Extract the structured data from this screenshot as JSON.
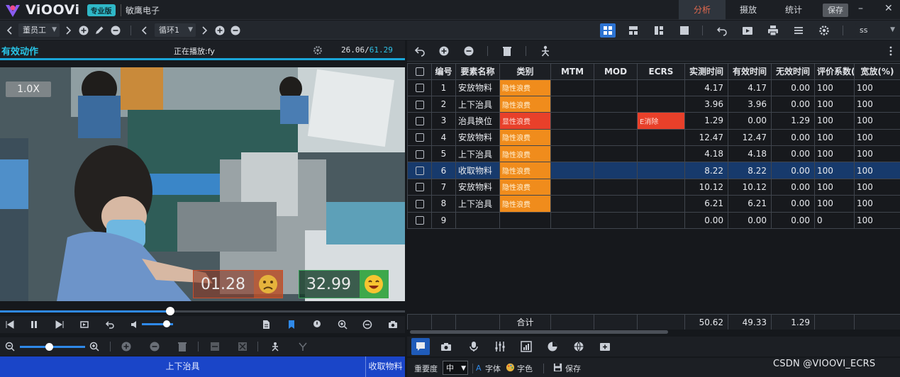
{
  "app": {
    "name": "ViOOVi",
    "edition_badge": "专业版",
    "company": "敏鹰电子"
  },
  "top_tabs": {
    "analysis": "分析",
    "playback": "摄放",
    "stats": "统计"
  },
  "top_save": "保存",
  "toolbar": {
    "operator_select": "董员工",
    "cycle_select": "循环1",
    "right_select": "ss"
  },
  "video": {
    "section_title": "有效动作",
    "playing_label": "正在播放:fy",
    "time_current": "26.06/",
    "time_total": "61.29",
    "speed": "1.0X",
    "timer_waste": "01.28",
    "timer_valid": "32.99",
    "scrub_progress": 0.42,
    "volume_level": 0.8,
    "zoom_level": 0.45
  },
  "timeline": {
    "current": "上下治具",
    "next": "收取物料"
  },
  "table": {
    "headers": [
      "编号",
      "要素名称",
      "类别",
      "MTM",
      "MOD",
      "ECRS",
      "实测时间",
      "有效时间",
      "无效时间",
      "评价系数(%",
      "宽放(%)"
    ],
    "rows": [
      {
        "no": "1",
        "name": "安放物料",
        "category": "隐性浪费",
        "cat_color": "orange",
        "mtm": "",
        "mod": "",
        "ecrs": "",
        "measured": "4.17",
        "valid": "4.17",
        "invalid": "0.00",
        "rating": "100",
        "allowance": "100"
      },
      {
        "no": "2",
        "name": "上下治具",
        "category": "隐性浪费",
        "cat_color": "orange",
        "mtm": "",
        "mod": "",
        "ecrs": "",
        "measured": "3.96",
        "valid": "3.96",
        "invalid": "0.00",
        "rating": "100",
        "allowance": "100"
      },
      {
        "no": "3",
        "name": "治具换位",
        "category": "显性浪费",
        "cat_color": "red",
        "mtm": "",
        "mod": "",
        "ecrs": "E消除",
        "measured": "1.29",
        "valid": "0.00",
        "invalid": "1.29",
        "rating": "100",
        "allowance": "100"
      },
      {
        "no": "4",
        "name": "安放物料",
        "category": "隐性浪费",
        "cat_color": "orange",
        "mtm": "",
        "mod": "",
        "ecrs": "",
        "measured": "12.47",
        "valid": "12.47",
        "invalid": "0.00",
        "rating": "100",
        "allowance": "100"
      },
      {
        "no": "5",
        "name": "上下治具",
        "category": "隐性浪费",
        "cat_color": "orange",
        "mtm": "",
        "mod": "",
        "ecrs": "",
        "measured": "4.18",
        "valid": "4.18",
        "invalid": "0.00",
        "rating": "100",
        "allowance": "100"
      },
      {
        "no": "6",
        "name": "收取物料",
        "category": "隐性浪费",
        "cat_color": "orange",
        "mtm": "",
        "mod": "",
        "ecrs": "",
        "measured": "8.22",
        "valid": "8.22",
        "invalid": "0.00",
        "rating": "100",
        "allowance": "100",
        "selected": true
      },
      {
        "no": "7",
        "name": "安放物料",
        "category": "隐性浪费",
        "cat_color": "orange",
        "mtm": "",
        "mod": "",
        "ecrs": "",
        "measured": "10.12",
        "valid": "10.12",
        "invalid": "0.00",
        "rating": "100",
        "allowance": "100"
      },
      {
        "no": "8",
        "name": "上下治具",
        "category": "隐性浪费",
        "cat_color": "orange",
        "mtm": "",
        "mod": "",
        "ecrs": "",
        "measured": "6.21",
        "valid": "6.21",
        "invalid": "0.00",
        "rating": "100",
        "allowance": "100"
      },
      {
        "no": "9",
        "name": "",
        "category": "",
        "cat_color": "",
        "mtm": "",
        "mod": "",
        "ecrs": "",
        "measured": "0.00",
        "valid": "0.00",
        "invalid": "0.00",
        "rating": "0",
        "allowance": "100"
      }
    ],
    "totals": {
      "label": "合计",
      "measured": "50.62",
      "valid": "49.33",
      "invalid": "1.29"
    }
  },
  "format_bar": {
    "importance_label": "重要度",
    "importance_value": "中",
    "font_label": "字体",
    "font_color_label": "字色",
    "save_label": "保存"
  },
  "watermark": "CSDN @VIOOVI_ECRS",
  "colors": {
    "accent": "#2c73d2",
    "orange": "#f08c1c",
    "red": "#e8402a",
    "cyan": "#28c4e6",
    "timeline": "#1a45c8"
  }
}
